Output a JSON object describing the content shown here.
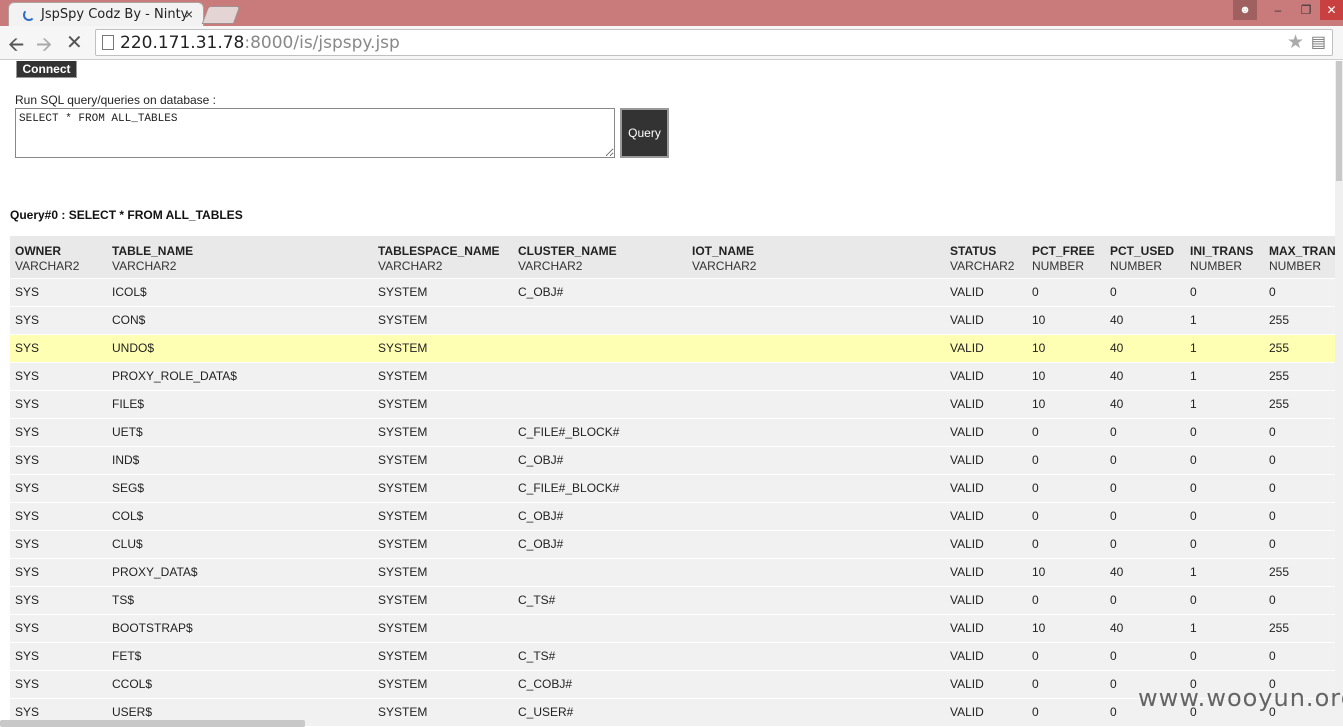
{
  "browser": {
    "tab_title": "JspSpy Codz By - Ninty",
    "tab_close": "×",
    "url_host": "220.171.31.78",
    "url_path": ":8000/is/jspspy.jsp",
    "user_icon": "person-icon"
  },
  "form": {
    "connect_label": "Connect",
    "sql_label": "Run SQL query/queries on database :",
    "sql_value": "SELECT * FROM ALL_TABLES",
    "query_label": "Query"
  },
  "results": {
    "title": "Query#0 : SELECT * FROM ALL_TABLES",
    "columns": [
      {
        "name": "OWNER",
        "type": "VARCHAR2"
      },
      {
        "name": "TABLE_NAME",
        "type": "VARCHAR2"
      },
      {
        "name": "TABLESPACE_NAME",
        "type": "VARCHAR2"
      },
      {
        "name": "CLUSTER_NAME",
        "type": "VARCHAR2"
      },
      {
        "name": "IOT_NAME",
        "type": "VARCHAR2"
      },
      {
        "name": "STATUS",
        "type": "VARCHAR2"
      },
      {
        "name": "PCT_FREE",
        "type": "NUMBER"
      },
      {
        "name": "PCT_USED",
        "type": "NUMBER"
      },
      {
        "name": "INI_TRANS",
        "type": "NUMBER"
      },
      {
        "name": "MAX_TRANS",
        "type": "NUMBER"
      }
    ],
    "highlighted_row": 2,
    "rows": [
      [
        "SYS",
        "ICOL$",
        "SYSTEM",
        "C_OBJ#",
        "",
        "VALID",
        "0",
        "0",
        "0",
        "0"
      ],
      [
        "SYS",
        "CON$",
        "SYSTEM",
        "",
        "",
        "VALID",
        "10",
        "40",
        "1",
        "255"
      ],
      [
        "SYS",
        "UNDO$",
        "SYSTEM",
        "",
        "",
        "VALID",
        "10",
        "40",
        "1",
        "255"
      ],
      [
        "SYS",
        "PROXY_ROLE_DATA$",
        "SYSTEM",
        "",
        "",
        "VALID",
        "10",
        "40",
        "1",
        "255"
      ],
      [
        "SYS",
        "FILE$",
        "SYSTEM",
        "",
        "",
        "VALID",
        "10",
        "40",
        "1",
        "255"
      ],
      [
        "SYS",
        "UET$",
        "SYSTEM",
        "C_FILE#_BLOCK#",
        "",
        "VALID",
        "0",
        "0",
        "0",
        "0"
      ],
      [
        "SYS",
        "IND$",
        "SYSTEM",
        "C_OBJ#",
        "",
        "VALID",
        "0",
        "0",
        "0",
        "0"
      ],
      [
        "SYS",
        "SEG$",
        "SYSTEM",
        "C_FILE#_BLOCK#",
        "",
        "VALID",
        "0",
        "0",
        "0",
        "0"
      ],
      [
        "SYS",
        "COL$",
        "SYSTEM",
        "C_OBJ#",
        "",
        "VALID",
        "0",
        "0",
        "0",
        "0"
      ],
      [
        "SYS",
        "CLU$",
        "SYSTEM",
        "C_OBJ#",
        "",
        "VALID",
        "0",
        "0",
        "0",
        "0"
      ],
      [
        "SYS",
        "PROXY_DATA$",
        "SYSTEM",
        "",
        "",
        "VALID",
        "10",
        "40",
        "1",
        "255"
      ],
      [
        "SYS",
        "TS$",
        "SYSTEM",
        "C_TS#",
        "",
        "VALID",
        "0",
        "0",
        "0",
        "0"
      ],
      [
        "SYS",
        "BOOTSTRAP$",
        "SYSTEM",
        "",
        "",
        "VALID",
        "10",
        "40",
        "1",
        "255"
      ],
      [
        "SYS",
        "FET$",
        "SYSTEM",
        "C_TS#",
        "",
        "VALID",
        "0",
        "0",
        "0",
        "0"
      ],
      [
        "SYS",
        "CCOL$",
        "SYSTEM",
        "C_COBJ#",
        "",
        "VALID",
        "0",
        "0",
        "0",
        "0"
      ],
      [
        "SYS",
        "USER$",
        "SYSTEM",
        "C_USER#",
        "",
        "VALID",
        "0",
        "0",
        "0",
        "0"
      ]
    ]
  },
  "watermark": "www.wooyun.org",
  "colors": {
    "highlight": "#ffffb3",
    "row": "#f1f1f1",
    "titlebar": "#c97b7b"
  }
}
